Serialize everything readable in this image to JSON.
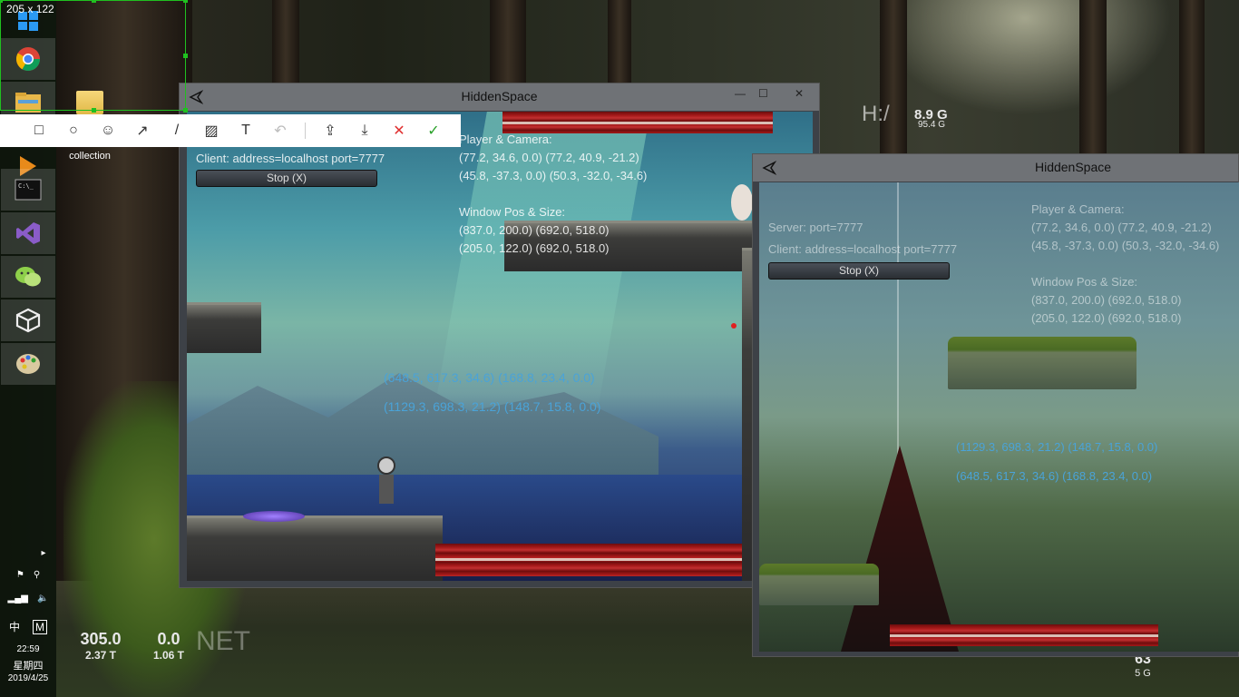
{
  "selection": {
    "size_label": "205 x 122"
  },
  "toolbar": {
    "tools": [
      {
        "name": "rectangle-tool",
        "glyph": "□"
      },
      {
        "name": "ellipse-tool",
        "glyph": "○"
      },
      {
        "name": "emoji-tool",
        "glyph": "☺"
      },
      {
        "name": "arrow-tool",
        "glyph": "↗"
      },
      {
        "name": "pen-tool",
        "glyph": "/"
      },
      {
        "name": "mosaic-tool",
        "glyph": "▨"
      },
      {
        "name": "text-tool",
        "glyph": "T"
      },
      {
        "name": "undo-tool",
        "glyph": "↶"
      }
    ],
    "actions": [
      {
        "name": "share-button",
        "glyph": "⇪"
      },
      {
        "name": "save-button",
        "glyph": "⤓"
      },
      {
        "name": "cancel-button",
        "glyph": "✕",
        "color": "#e03030"
      },
      {
        "name": "confirm-button",
        "glyph": "✓",
        "color": "#2aa02a"
      }
    ]
  },
  "desktop": {
    "folder_label": "collection"
  },
  "taskbar": {
    "icons": [
      "windows-start-icon",
      "chrome-icon",
      "file-explorer-icon",
      "media-player-icon",
      "terminal-icon",
      "visual-studio-icon",
      "wechat-icon",
      "unity-icon",
      "paint-icon"
    ],
    "tray_time": "22:59",
    "tray_weekday": "星期四",
    "tray_date": "2019/4/25",
    "ime_label": "中",
    "m_label": "M"
  },
  "monitors": {
    "disk_top": {
      "label": "H:/",
      "value": "8.9 G",
      "sub": "95.4 G"
    },
    "net_left": {
      "value": "305.0",
      "sub": "2.37 T"
    },
    "net_right": {
      "value": "0.0",
      "sub": "1.06 T"
    },
    "net_label": "NET",
    "bottom_right": {
      "value": "63",
      "sub": "5 G"
    }
  },
  "client_window": {
    "title": "HiddenSpace",
    "client_info": "Client: address=localhost port=7777",
    "stop_label": "Stop (X)",
    "player_camera_label": "Player & Camera:",
    "pc_line1": "(77.2, 34.6, 0.0) (77.2, 40.9, -21.2)",
    "pc_line2": "(45.8, -37.3, 0.0) (50.3, -32.0, -34.6)",
    "window_pos_label": "Window Pos & Size:",
    "wp_line1": "(837.0, 200.0) (692.0, 518.0)",
    "wp_line2": "(205.0, 122.0) (692.0, 518.0)",
    "blue1": "(648.5, 617.3, 34.6) (168.8, 23.4, 0.0)",
    "blue2": "(1129.3, 698.3, 21.2) (148.7, 15.8, 0.0)"
  },
  "server_window": {
    "title": "HiddenSpace",
    "server_info": "Server: port=7777",
    "client_info": "Client: address=localhost port=7777",
    "stop_label": "Stop (X)",
    "player_camera_label": "Player & Camera:",
    "pc_line1": "(77.2, 34.6, 0.0) (77.2, 40.9, -21.2)",
    "pc_line2": "(45.8, -37.3, 0.0) (50.3, -32.0, -34.6)",
    "window_pos_label": "Window Pos & Size:",
    "wp_line1": "(837.0, 200.0) (692.0, 518.0)",
    "wp_line2": "(205.0, 122.0) (692.0, 518.0)",
    "blue1": "(1129.3, 698.3, 21.2) (148.7, 15.8, 0.0)",
    "blue2": "(648.5, 617.3, 34.6) (168.8, 23.4, 0.0)"
  },
  "window_controls": {
    "minimize": "—",
    "maximize": "☐",
    "close": "✕"
  }
}
